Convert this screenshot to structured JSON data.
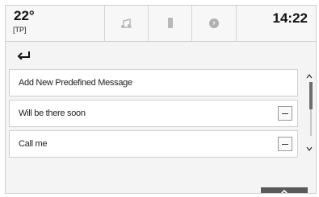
{
  "status": {
    "temperature": "22°",
    "traffic_program": "[TP]",
    "time": "14:22",
    "tabs": [
      {
        "icon": "audio-icon"
      },
      {
        "icon": "phone-icon"
      },
      {
        "icon": "navigation-icon"
      }
    ]
  },
  "toolbar": {
    "back_icon": "back-arrow-icon"
  },
  "messages": {
    "items": [
      {
        "label": "Add New Predefined Message",
        "deletable": false
      },
      {
        "label": "Will be there soon",
        "deletable": true
      },
      {
        "label": "Call me",
        "deletable": true
      }
    ]
  },
  "scrollbar": {
    "up_icon": "scroll-up-icon",
    "down_icon": "scroll-down-icon"
  },
  "footer": {
    "collapse_icon": "chevron-up-icon"
  }
}
